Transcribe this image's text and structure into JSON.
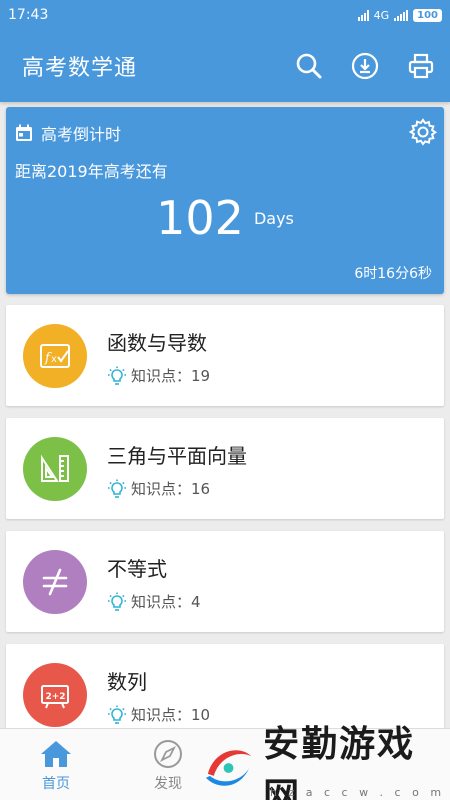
{
  "status_bar": {
    "time": "17:43",
    "network": "4G",
    "battery": "100"
  },
  "app_bar": {
    "title": "高考数学通",
    "actions": [
      "search-icon",
      "download-icon",
      "print-icon"
    ]
  },
  "countdown": {
    "header": "高考倒计时",
    "subtitle": "距离2019年高考还有",
    "days": "102",
    "days_unit": "Days",
    "time_left": "6时16分6秒"
  },
  "topics": [
    {
      "name": "函数与导数",
      "kp_label": "知识点：19",
      "color": "#f1b025",
      "icon": "function-icon"
    },
    {
      "name": "三角与平面向量",
      "kp_label": "知识点：16",
      "color": "#7dc048",
      "icon": "ruler-triangle-icon"
    },
    {
      "name": "不等式",
      "kp_label": "知识点：4",
      "color": "#b07fc0",
      "icon": "not-equal-icon"
    },
    {
      "name": "数列",
      "kp_label": "知识点：10",
      "color": "#e8584a",
      "icon": "sequence-board-icon"
    }
  ],
  "bottom_nav": [
    {
      "label": "首页",
      "icon": "home-icon",
      "active": true
    },
    {
      "label": "发现",
      "icon": "compass-icon",
      "active": false
    }
  ],
  "watermark": {
    "text": "安勤游戏网",
    "url": "h z a c c w . c o m"
  },
  "colors": {
    "primary": "#4a98dc",
    "kp_icon": "#2fb4d6"
  }
}
